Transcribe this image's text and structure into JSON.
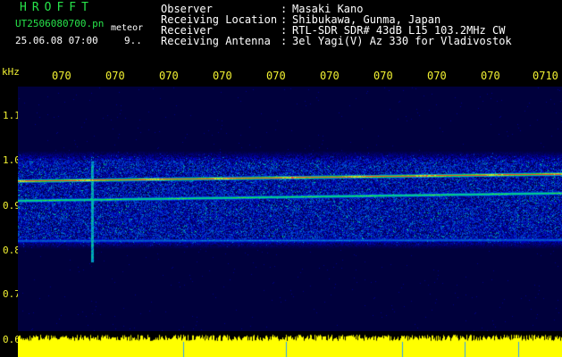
{
  "header": {
    "app_name": "HROFFT",
    "filename": "UT2506080700.pn",
    "event_tag": "meteor",
    "datetime": "25.06.08 07:00",
    "counter": "9.."
  },
  "metadata": [
    {
      "label": "Observer",
      "value": "Masaki Kano"
    },
    {
      "label": "Receiving Location",
      "value": "Shibukawa, Gunma, Japan"
    },
    {
      "label": "Receiver",
      "value": "RTL-SDR SDR# 43dB L15 103.2MHz CW"
    },
    {
      "label": "Receiving Antenna",
      "value": "3el Yagi(V) Az 330 for Vladivostok"
    }
  ],
  "colon": ":",
  "axis": {
    "unit": "kHz",
    "y_ticks": [
      "1.1",
      "1.0",
      "0.9",
      "0.8",
      "0.7",
      "0.6"
    ],
    "x_ticks": [
      "070",
      "070",
      "070",
      "070",
      "070",
      "070",
      "070",
      "070",
      "070",
      "0710"
    ]
  },
  "colors": {
    "text_green": "#27e34a",
    "text_white": "#ffffff",
    "text_yellow": "#f2f232",
    "background": "#000000",
    "amplitude": "#ffff00",
    "signal_red": "#ff3030"
  },
  "chart_data": {
    "type": "heatmap",
    "ylabel": "kHz",
    "ylim": [
      0.6,
      1.15
    ],
    "x_tick_labels": [
      "070",
      "070",
      "070",
      "070",
      "070",
      "070",
      "070",
      "070",
      "070",
      "0710"
    ],
    "y_tick_labels": [
      "1.1",
      "1.0",
      "0.9",
      "0.8",
      "0.7",
      "0.6"
    ],
    "noise_band_khz": [
      0.79,
      1.01
    ],
    "lines": [
      {
        "freq_khz_start": 0.942,
        "freq_khz_end": 0.958,
        "intensity": "high"
      },
      {
        "freq_khz_start": 0.898,
        "freq_khz_end": 0.915,
        "intensity": "medium"
      },
      {
        "freq_khz_start": 0.808,
        "freq_khz_end": 0.81,
        "intensity": "low"
      }
    ],
    "meteor_echo_x_minutes": 1.3
  }
}
